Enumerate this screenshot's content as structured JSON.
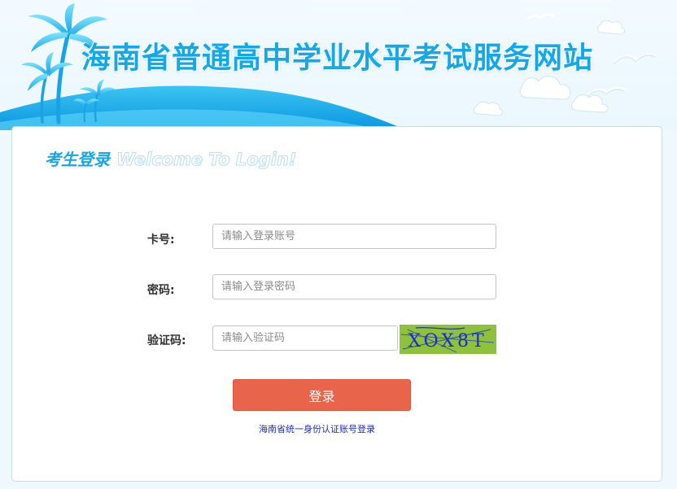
{
  "header": {
    "site_title": "海南省普通高中学业水平考试服务网站"
  },
  "login": {
    "heading_zh": "考生登录",
    "heading_en": "Welcome To Login!",
    "card_label": "卡号:",
    "card_placeholder": "请输入登录账号",
    "password_label": "密码:",
    "password_placeholder": "请输入登录密码",
    "captcha_label": "验证码:",
    "captcha_placeholder": "请输入验证码",
    "captcha_text": "XOX8T",
    "submit_label": "登录",
    "id_login_link": "海南省统一身份认证账号登录"
  },
  "colors": {
    "accent": "#1aa4e3",
    "button": "#e8644b",
    "link": "#1b2fb8",
    "captcha_bg": "#8fc13d",
    "captcha_text": "#1a2bd0"
  },
  "icons": [
    "palm-tree-icon",
    "seagull-icon",
    "cloud-icon"
  ]
}
